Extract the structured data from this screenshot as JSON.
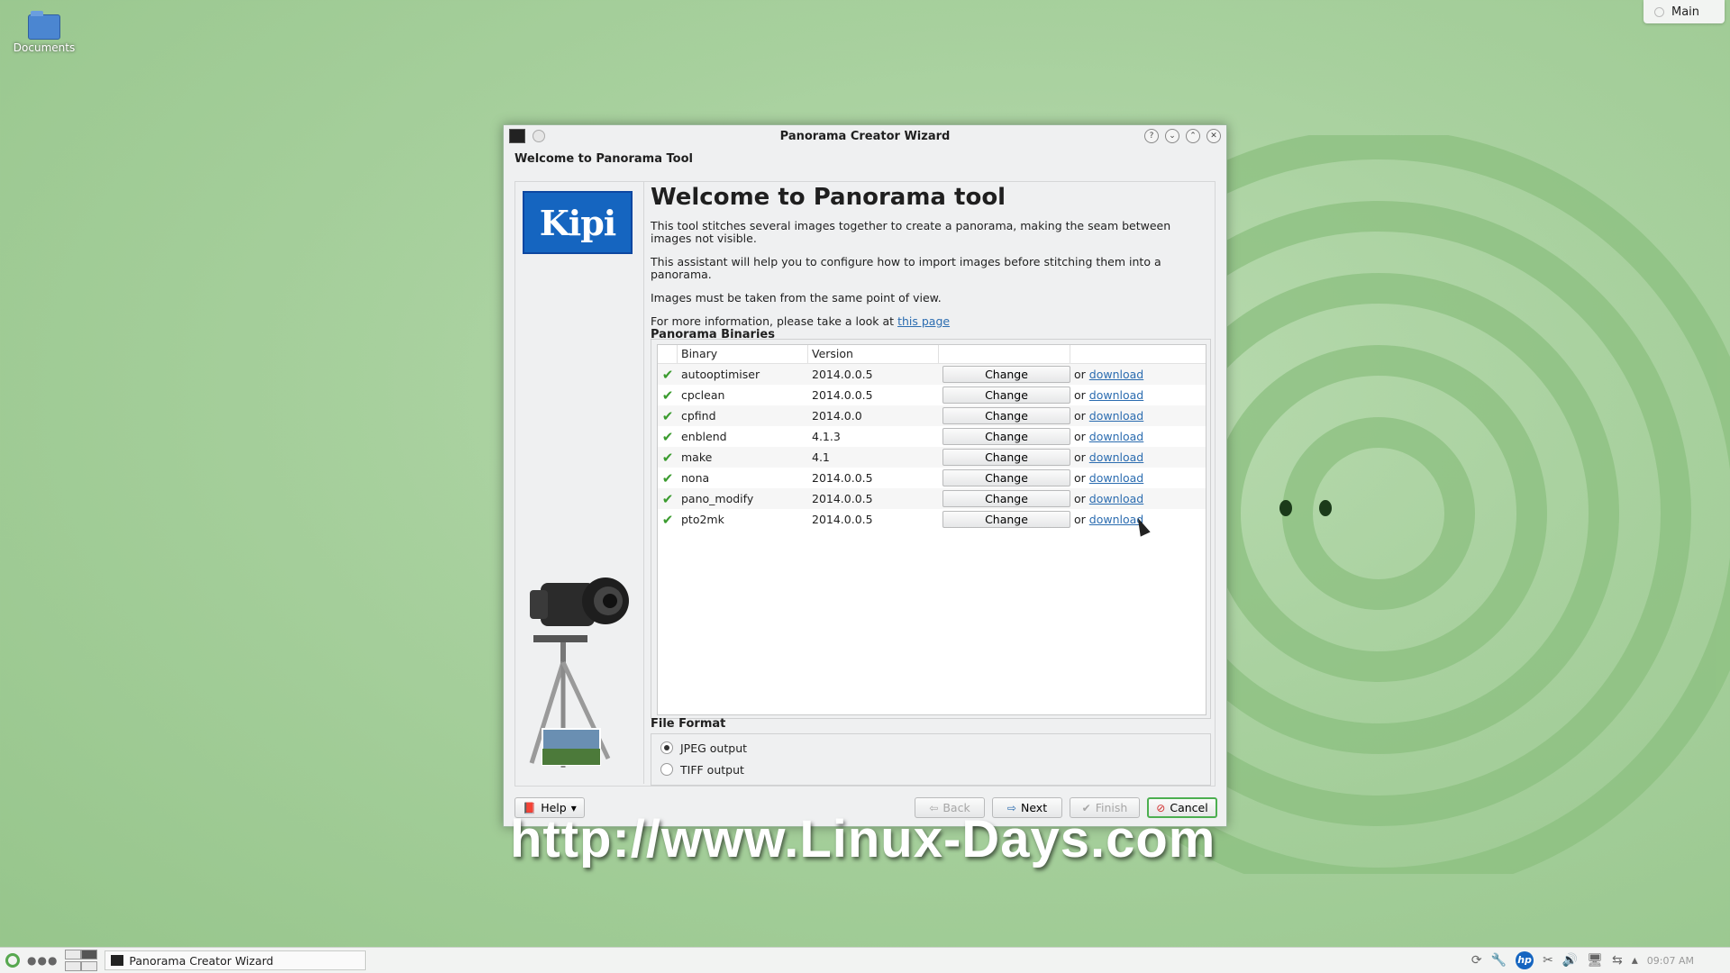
{
  "desktop": {
    "icon_label": "Documents",
    "activity_label": "Main",
    "watermark": "http://www.Linux-Days.com"
  },
  "window": {
    "title": "Panorama Creator Wizard",
    "page_title": "Welcome to Panorama Tool",
    "logo_text": "Kipi",
    "heading": "Welcome to Panorama tool",
    "paragraphs": [
      "This tool stitches several images together to create a panorama, making the seam between images not visible.",
      "This assistant will help you to configure how to import images before stitching them into a panorama.",
      "Images must be taken from the same point of view."
    ],
    "more_info_prefix": "For more information, please take a look at",
    "more_info_link": "this page",
    "binaries_title": "Panorama Binaries",
    "columns": [
      "Binary",
      "Version",
      "",
      ""
    ],
    "change_label": "Change",
    "or_label": "or",
    "download_label": "download",
    "binaries": [
      {
        "name": "autooptimiser",
        "version": "2014.0.0.5"
      },
      {
        "name": "cpclean",
        "version": "2014.0.0.5"
      },
      {
        "name": "cpfind",
        "version": "2014.0.0"
      },
      {
        "name": "enblend",
        "version": "4.1.3"
      },
      {
        "name": "make",
        "version": "4.1"
      },
      {
        "name": "nona",
        "version": "2014.0.0.5"
      },
      {
        "name": "pano_modify",
        "version": "2014.0.0.5"
      },
      {
        "name": "pto2mk",
        "version": "2014.0.0.5"
      }
    ],
    "file_format_title": "File Format",
    "formats": [
      {
        "label": "JPEG output",
        "selected": true
      },
      {
        "label": "TIFF output",
        "selected": false
      }
    ],
    "buttons": {
      "help": "Help",
      "back": "Back",
      "next": "Next",
      "finish": "Finish",
      "cancel": "Cancel"
    }
  },
  "taskbar": {
    "task_label": "Panorama Creator Wizard",
    "tray_hp": "hp",
    "clock": "09:07 AM"
  },
  "colors": {
    "accent": "#4caf50",
    "link": "#2b6cb0",
    "check": "#3a9b2e"
  }
}
